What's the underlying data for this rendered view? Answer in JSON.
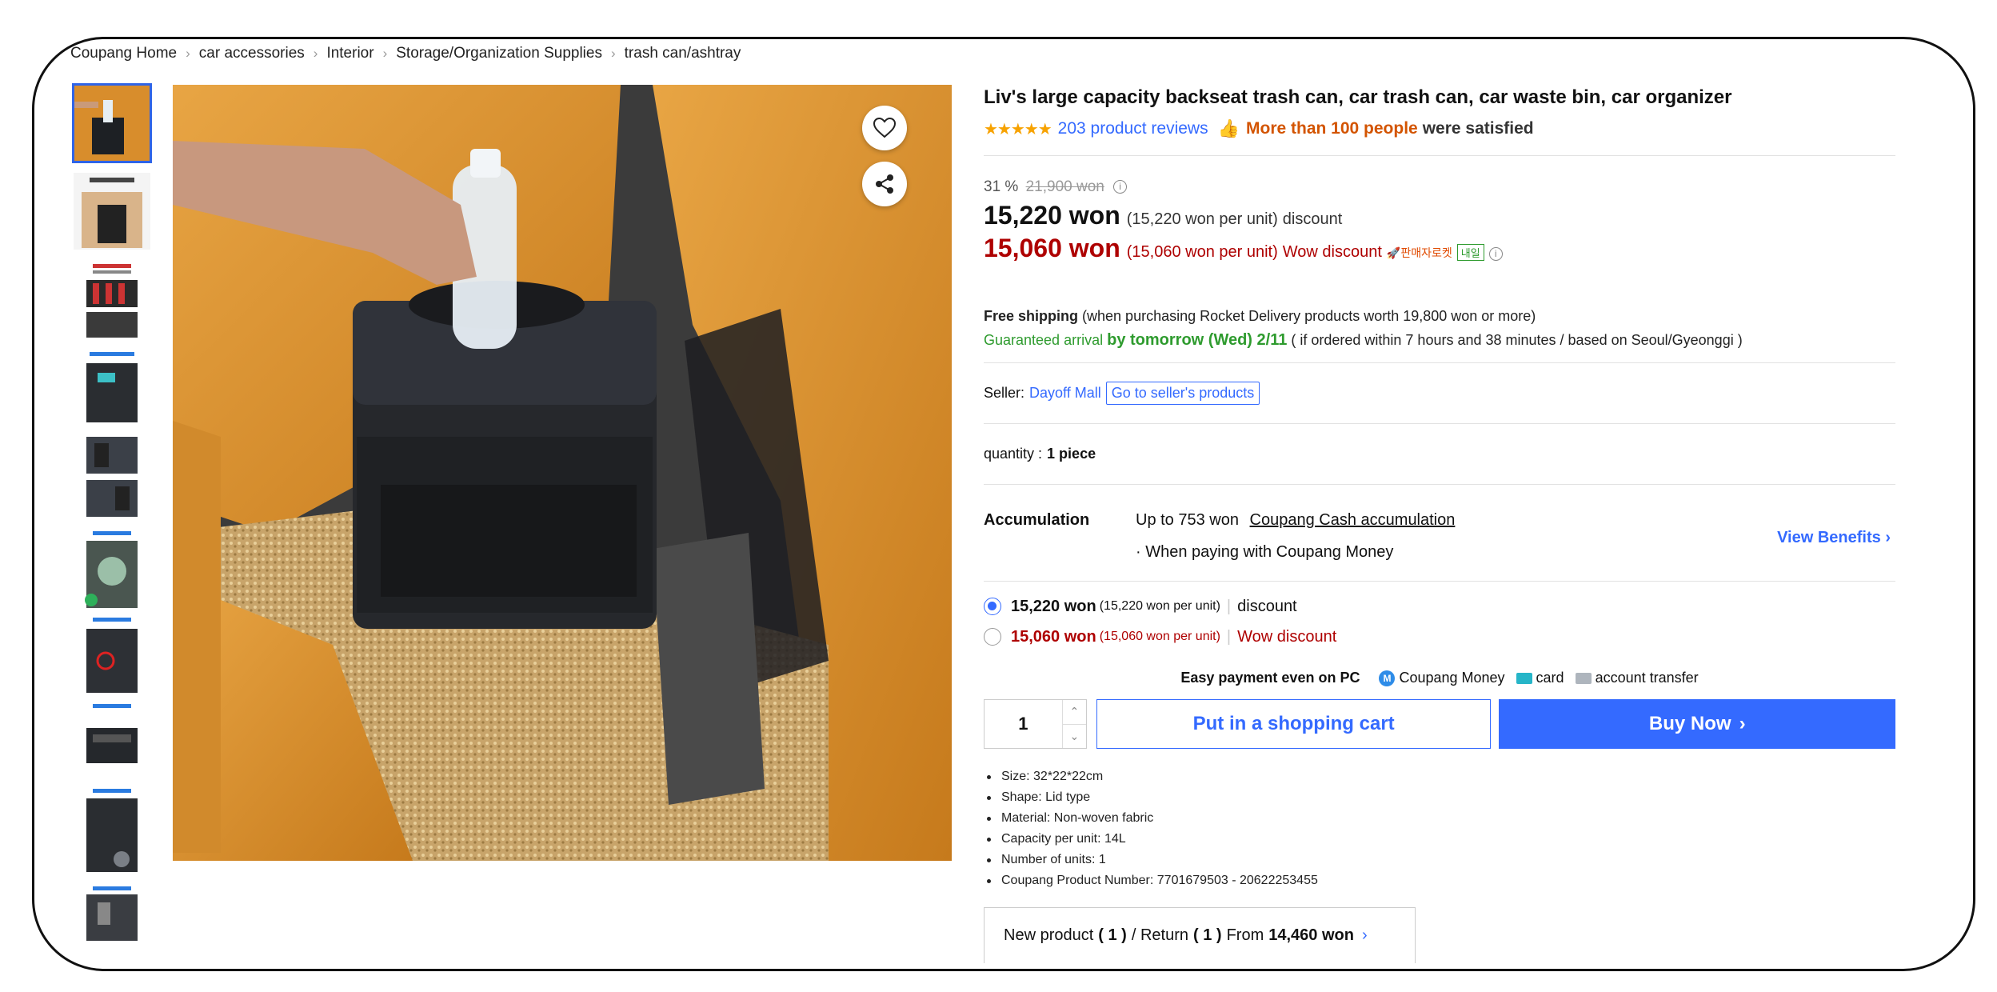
{
  "breadcrumb": [
    "Coupang Home",
    "car accessories",
    "Interior",
    "Storage/Organization Supplies",
    "trash can/ashtray"
  ],
  "product": {
    "title": "Liv's large capacity backseat trash can, car trash can, car waste bin, car organizer",
    "stars": "★★★★★",
    "reviews": "203 product reviews",
    "satisfied_highlight": "More than 100 people",
    "satisfied_rest": "were satisfied"
  },
  "pricing": {
    "discount_rate": "31 %",
    "original_price": "21,900 won",
    "price1": "15,220 won",
    "price1_unit": "(15,220 won per unit)",
    "price1_label": "discount",
    "price2": "15,060 won",
    "price2_unit": "(15,060 won per unit)",
    "price2_label": "Wow discount",
    "rocket_badge": "🚀판매자로켓",
    "tomorrow_badge": "내일"
  },
  "shipping": {
    "free_label": "Free shipping",
    "free_note": "(when purchasing Rocket Delivery products worth 19,800 won or more)",
    "guaranteed": "Guaranteed arrival",
    "arrival": "by tomorrow (Wed) 2/11",
    "arrival_note": "( if ordered within 7 hours and 38 minutes / based on Seoul/Gyeonggi )"
  },
  "seller": {
    "label": "Seller:",
    "name": "Dayoff Mall",
    "button": "Go to seller's products"
  },
  "quantity_row": {
    "label": "quantity :",
    "value": "1 piece"
  },
  "accumulation": {
    "label": "Accumulation",
    "amount": "Up to 753 won",
    "link": "Coupang Cash accumulation",
    "note": "· When paying with Coupang Money",
    "benefits": "View Benefits"
  },
  "options": [
    {
      "price": "15,220 won",
      "unit": "(15,220 won per unit)",
      "label": "discount"
    },
    {
      "price": "15,060 won",
      "unit": "(15,060 won per unit)",
      "label": "Wow discount"
    }
  ],
  "payment": {
    "label": "Easy payment even on PC",
    "coin_letter": "M",
    "methods": [
      "Coupang Money",
      "card",
      "account transfer"
    ]
  },
  "purchase": {
    "qty": "1",
    "cart_button": "Put in a shopping cart",
    "buy_button": "Buy Now"
  },
  "specs": [
    "Size: 32*22*22cm",
    "Shape: Lid type",
    "Material: Non-woven fabric",
    "Capacity per unit: 14L",
    "Number of units: 1",
    "Coupang Product Number: 7701679503 - 20622253455"
  ],
  "new_product": {
    "text1": "New product",
    "count1": "( 1 )",
    "text2": "/ Return",
    "count2": "( 1 )",
    "text3": "From",
    "price": "14,460 won"
  }
}
